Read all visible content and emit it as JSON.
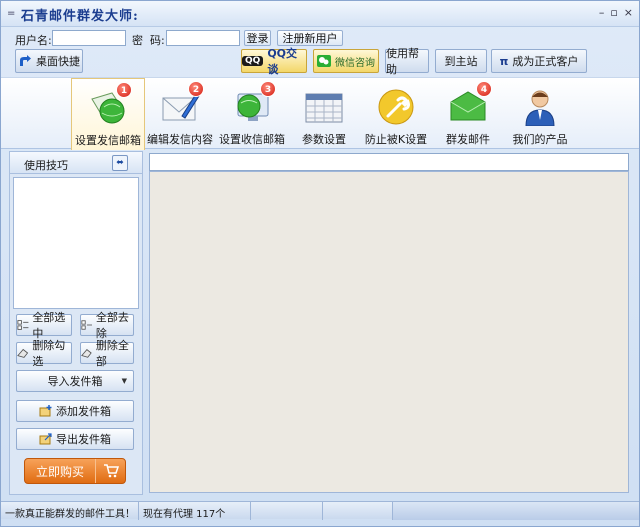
{
  "window": {
    "menu_glyph": "=",
    "title": "石青邮件群发大师:",
    "min_glyph": "–",
    "restore_glyph": "▫",
    "close_glyph": "×"
  },
  "login": {
    "username_label": "用户名:",
    "username_value": "",
    "password_label": "密  码:",
    "password_value": "",
    "login_button": "登录",
    "register_button": "注册新用户"
  },
  "toolbar": {
    "desktop_shortcut": "桌面快捷",
    "qq_chip": "QQ",
    "qq_label": "QQ交谈",
    "wechat_label": "微信咨询",
    "help": "使用帮助",
    "home": "到主站",
    "pi_glyph": "π",
    "become_customer": "成为正式客户"
  },
  "ribbon": {
    "tabs": [
      {
        "label": "设置发信邮箱",
        "badge": "1",
        "icon": "green-globe-envelope-icon"
      },
      {
        "label": "编辑发信内容",
        "badge": "2",
        "icon": "envelope-pen-icon"
      },
      {
        "label": "设置收信邮箱",
        "badge": "3",
        "icon": "globe-monitor-icon"
      },
      {
        "label": "参数设置",
        "badge": "",
        "icon": "calendar-grid-icon"
      },
      {
        "label": "防止被K设置",
        "badge": "",
        "icon": "wrench-icon"
      },
      {
        "label": "群发邮件",
        "badge": "4",
        "icon": "green-envelope-icon"
      },
      {
        "label": "我们的产品",
        "badge": "",
        "icon": "user-person-icon"
      }
    ]
  },
  "left_panel": {
    "header": "使用技巧",
    "select_all": "全部选中",
    "deselect_all": "全部去除",
    "delete_checked": "删除勾选",
    "delete_all": "删除全部",
    "import_outbox": "导入发件箱",
    "add_outbox": "添加发件箱",
    "export_outbox": "导出发件箱",
    "buy_now": "立即购买"
  },
  "right_panel": {
    "address_value": ""
  },
  "status": {
    "slogan": "一款真正能群发的邮件工具！",
    "proxy_count": "现在有代理 117个"
  },
  "colors": {
    "accent_blue": "#1b3d8f",
    "badge_red": "#d21a0f",
    "buy_orange": "#e8771a",
    "content_bg": "#ece9e2"
  }
}
